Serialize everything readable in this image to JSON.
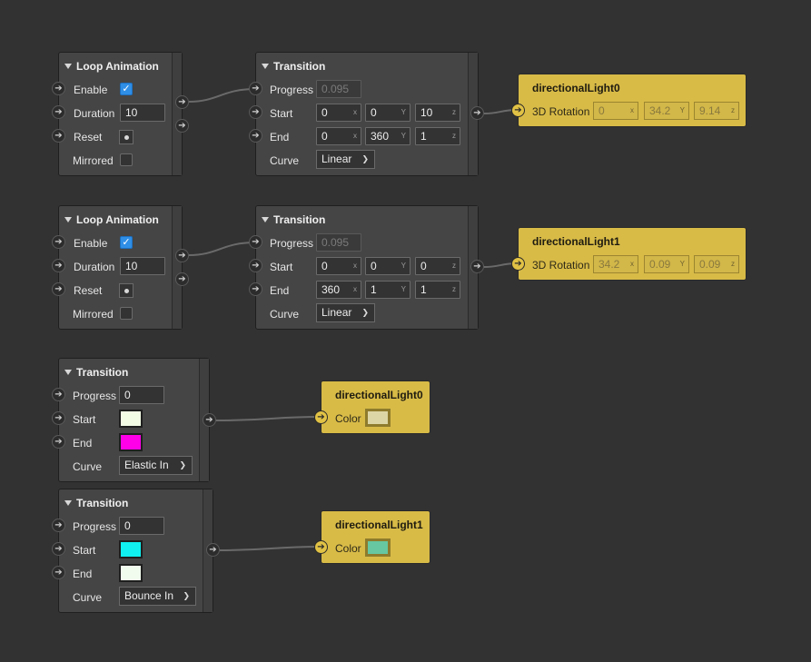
{
  "loop0": {
    "title": "Loop Animation",
    "enable_label": "Enable",
    "enable_checked": true,
    "duration_label": "Duration",
    "duration_value": "10",
    "reset_label": "Reset",
    "mirrored_label": "Mirrored",
    "mirrored_checked": false
  },
  "trans0": {
    "title": "Transition",
    "progress_label": "Progress",
    "progress_value": "0.095",
    "start_label": "Start",
    "start": {
      "x": "0",
      "y": "0",
      "z": "10"
    },
    "end_label": "End",
    "end": {
      "x": "0",
      "y": "360",
      "z": "1"
    },
    "curve_label": "Curve",
    "curve_value": "Linear"
  },
  "light0_rot": {
    "title": "directionalLight0",
    "prop_label": "3D Rotation",
    "value": {
      "x": "0",
      "y": "34.2",
      "z": "9.14"
    }
  },
  "loop1": {
    "title": "Loop Animation",
    "enable_label": "Enable",
    "enable_checked": true,
    "duration_label": "Duration",
    "duration_value": "10",
    "reset_label": "Reset",
    "mirrored_label": "Mirrored",
    "mirrored_checked": false
  },
  "trans1": {
    "title": "Transition",
    "progress_label": "Progress",
    "progress_value": "0.095",
    "start_label": "Start",
    "start": {
      "x": "0",
      "y": "0",
      "z": "0"
    },
    "end_label": "End",
    "end": {
      "x": "360",
      "y": "1",
      "z": "1"
    },
    "curve_label": "Curve",
    "curve_value": "Linear"
  },
  "light1_rot": {
    "title": "directionalLight1",
    "prop_label": "3D Rotation",
    "value": {
      "x": "34.2",
      "y": "0.09",
      "z": "0.09"
    }
  },
  "ctrans0": {
    "title": "Transition",
    "progress_label": "Progress",
    "progress_value": "0",
    "start_label": "Start",
    "start_color": "#f3fde6",
    "end_label": "End",
    "end_color": "#ff00e8",
    "curve_label": "Curve",
    "curve_value": "Elastic In"
  },
  "light0_color": {
    "title": "directionalLight0",
    "prop_label": "Color",
    "color": "#dcd6a6"
  },
  "ctrans1": {
    "title": "Transition",
    "progress_label": "Progress",
    "progress_value": "0",
    "start_label": "Start",
    "start_color": "#10f0f0",
    "end_label": "End",
    "end_color": "#f1fbee",
    "curve_label": "Curve",
    "curve_value": "Bounce In"
  },
  "light1_color": {
    "title": "directionalLight1",
    "prop_label": "Color",
    "color": "#66c7a0"
  },
  "axis": {
    "x": "x",
    "y": "Y",
    "z": "z"
  }
}
